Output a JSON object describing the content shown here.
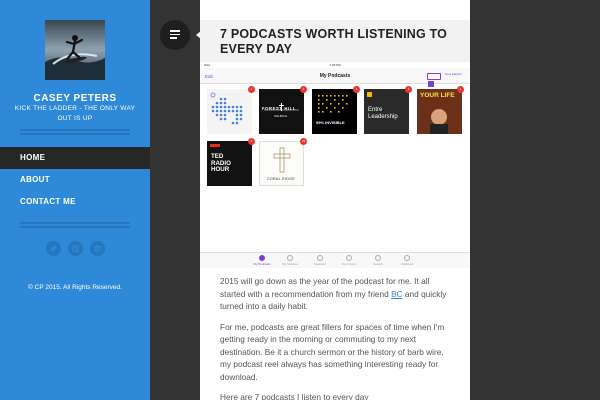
{
  "site": {
    "title": "CASEY PETERS",
    "tagline": "KICK THE LADDER - THE ONLY WAY OUT IS UP",
    "copyright": "© CP 2015. All Rights Reserved."
  },
  "nav": {
    "items": [
      {
        "label": "HOME",
        "active": true
      },
      {
        "label": "ABOUT",
        "active": false
      },
      {
        "label": "CONTACT ME",
        "active": false
      }
    ]
  },
  "social": [
    "twitter-icon",
    "instagram-icon",
    "linkedin-icon"
  ],
  "article": {
    "title": "7 PODCASTS WORTH LISTENING TO EVERY DAY",
    "paragraphs": {
      "p1_before": "2015 will go down as the year of the podcast for me. It all started with a recommendation from my friend ",
      "p1_link": "BC",
      "p1_after": " and quickly turned into a daily habit.",
      "p2": "For me, podcasts are great fillers for spaces of time when I'm getting ready in the morning or commuting to my next destination. Be it a church sermon or the history of barb wire, my podcast reel always has something interesting ready for download.",
      "p3": "Here are 7 podcasts I listen to every day"
    }
  },
  "ipad": {
    "status_left": "iPad",
    "status_time": "7:28 PM",
    "edit": "Edit",
    "title": "My Podcasts",
    "new": "New Playlist",
    "tiles": [
      {
        "name": "cast-arrow",
        "label": "",
        "badge": "2"
      },
      {
        "name": "forest-hill",
        "label": "FOREST HILL",
        "sub": "CHURCH",
        "badge": "1"
      },
      {
        "name": "99-invisible",
        "label": "99% INVISIBLE",
        "badge": "1"
      },
      {
        "name": "entreleadership",
        "label": "Entre Leadership",
        "badge": "1"
      },
      {
        "name": "your-life",
        "label": "YOUR LIFE",
        "badge": "1"
      },
      {
        "name": "ted-radio-hour",
        "label": "TED RADIO HOUR",
        "badge": "1"
      },
      {
        "name": "coral-ridge",
        "label": "CORAL RIDGE",
        "badge": "23"
      }
    ],
    "tabs": [
      "My Podcasts",
      "My Stations",
      "Featured",
      "Top Charts",
      "Search",
      "Unplayed"
    ]
  },
  "colors": {
    "sidebar": "#2e8ad8",
    "accent": "#7b3fd6",
    "link": "#2e8ad8"
  }
}
